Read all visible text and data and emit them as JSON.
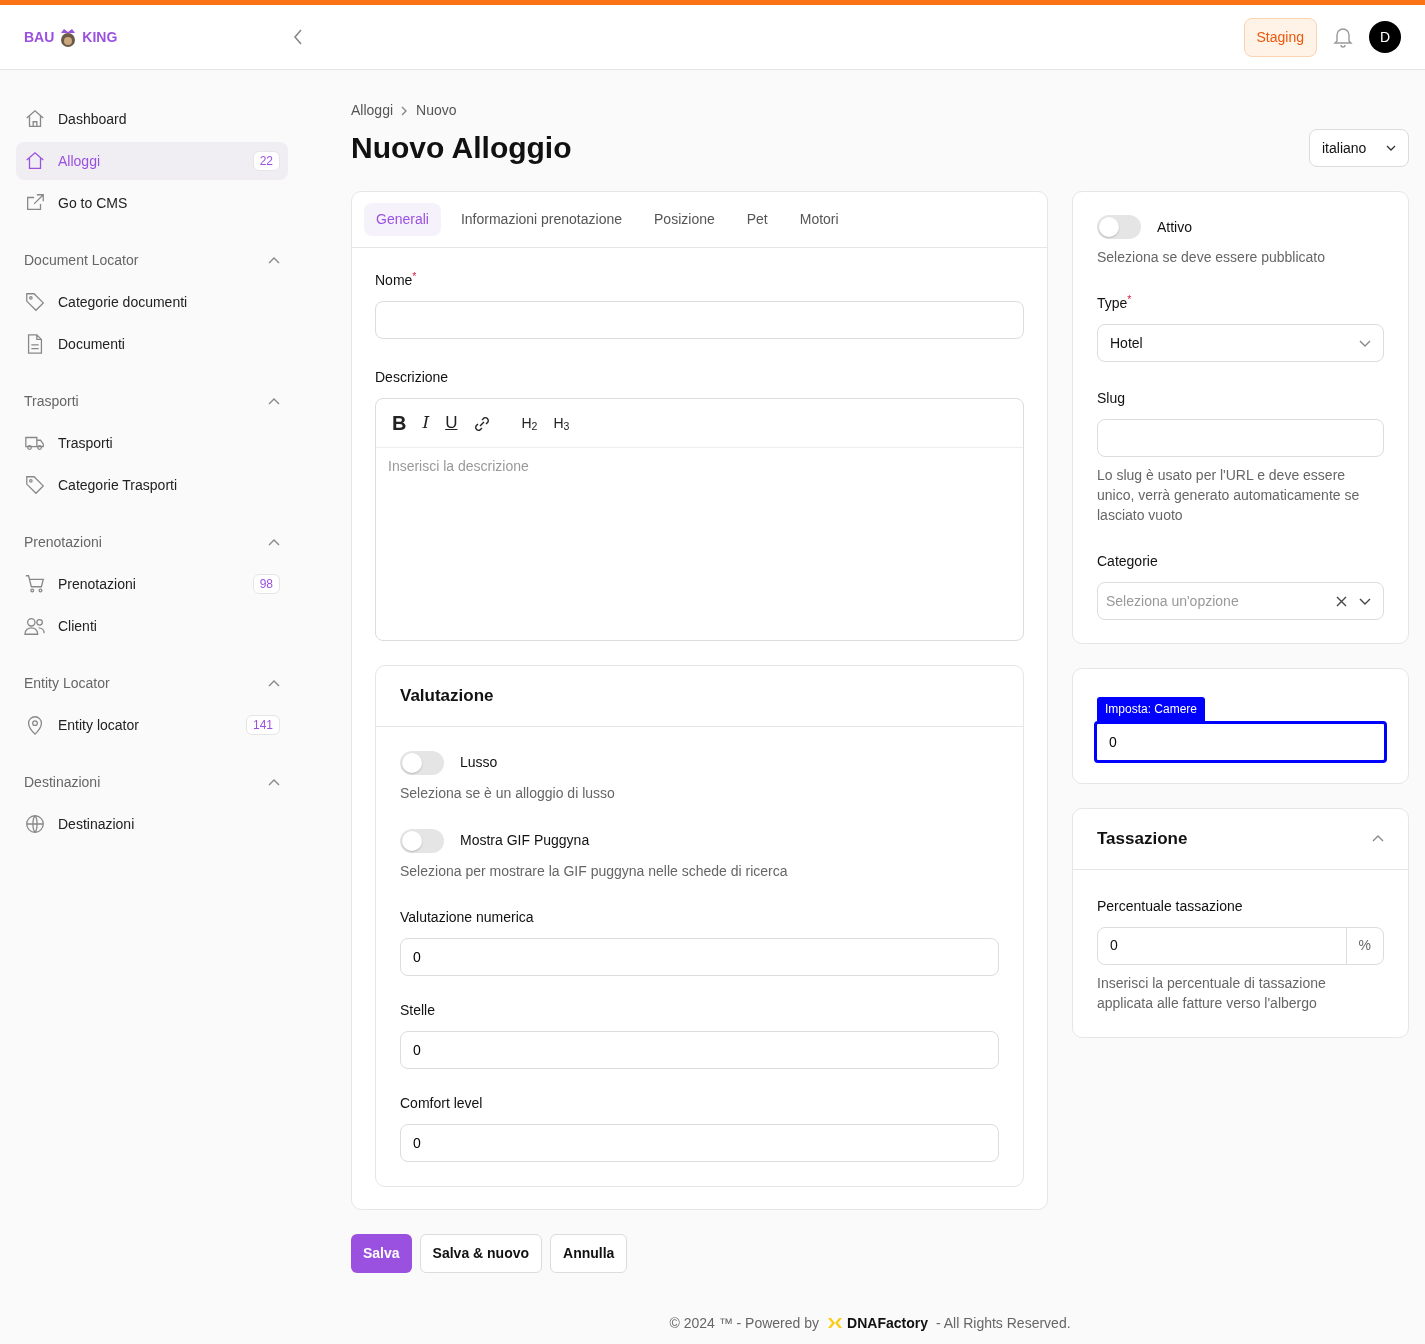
{
  "header": {
    "logo": {
      "left": "BAU",
      "right": "KING"
    },
    "environment": "Staging",
    "avatar": "D"
  },
  "sidebar": {
    "groups": [
      {
        "items": [
          {
            "label": "Dashboard",
            "selected": false
          },
          {
            "label": "Alloggi",
            "selected": true,
            "badge": "22"
          },
          {
            "label": "Go to CMS",
            "selected": false
          }
        ]
      },
      {
        "title": "Document Locator",
        "expanded": true,
        "items": [
          {
            "label": "Categorie documenti",
            "selected": false
          },
          {
            "label": "Documenti",
            "selected": false
          }
        ]
      },
      {
        "title": "Trasporti",
        "expanded": true,
        "items": [
          {
            "label": "Trasporti",
            "selected": false
          },
          {
            "label": "Categorie Trasporti",
            "selected": false
          }
        ]
      },
      {
        "title": "Prenotazioni",
        "expanded": true,
        "items": [
          {
            "label": "Prenotazioni",
            "selected": false,
            "badge": "98"
          },
          {
            "label": "Clienti",
            "selected": false
          }
        ]
      },
      {
        "title": "Entity Locator",
        "expanded": true,
        "items": [
          {
            "label": "Entity locator",
            "selected": false,
            "badge": "141"
          }
        ]
      },
      {
        "title": "Destinazioni",
        "expanded": true,
        "items": [
          {
            "label": "Destinazioni",
            "selected": false
          }
        ]
      }
    ]
  },
  "breadcrumb": [
    "Alloggi",
    "Nuovo"
  ],
  "title": "Nuovo Alloggio",
  "language": "italiano",
  "tabs": [
    {
      "label": "Generali",
      "selected": true
    },
    {
      "label": "Informazioni prenotazione",
      "selected": false
    },
    {
      "label": "Posizione",
      "selected": false
    },
    {
      "label": "Pet",
      "selected": false
    },
    {
      "label": "Motori",
      "selected": false
    }
  ],
  "nome": {
    "label": "Nome$^{*}$"
  },
  "descrizione": {
    "label": "Descrizione",
    "toolbar": [
      {
        "kind": "bold",
        "text": "B"
      },
      {
        "kind": "italic",
        "text": "I"
      },
      {
        "kind": "underline",
        "text": "U"
      },
      {
        "kind": "link"
      },
      {
        "kind": "heading",
        "text": "H$_{2}$"
      },
      {
        "kind": "heading",
        "text": "H$_{3}$"
      }
    ],
    "placeholder": "Inserisci la descrizione"
  },
  "valutazione": {
    "title": "Valutazione",
    "toggles": [
      {
        "label": "Lusso",
        "on": false,
        "help": "Seleziona se è un alloggio di lusso"
      },
      {
        "label": "Mostra GIF Puggyna",
        "on": false,
        "help": "Seleziona per mostrare la GIF puggyna nelle schede di ricerca"
      }
    ],
    "fields": [
      {
        "label": "Valutazione numerica",
        "value": "0"
      },
      {
        "label": "Stelle",
        "value": "0"
      },
      {
        "label": "Comfort level",
        "value": "0"
      }
    ]
  },
  "side": {
    "attivo": {
      "label": "Attivo",
      "on": false,
      "help": "Seleziona se deve essere pubblicato"
    },
    "type": {
      "label": "Type$^{*}$",
      "value": "Hotel"
    },
    "slug": {
      "label": "Slug",
      "help": "Lo slug è usato per l'URL e deve essere unico, verrà generato automaticamente se lasciato vuoto"
    },
    "categorie": {
      "label": "Categorie",
      "placeholder": "Seleziona un'opzione"
    }
  },
  "camere": {
    "tooltip": "Imposta: Camere",
    "value": "0"
  },
  "tassazione": {
    "title": "Tassazione",
    "expanded": true,
    "label": "Percentuale tassazione",
    "value": "0",
    "addon": "%",
    "help": "Inserisci la percentuale di tassazione applicata alle fatture verso l'albergo"
  },
  "buttons": [
    {
      "label": "Salva",
      "kind": "primary"
    },
    {
      "label": "Salva & nuovo",
      "kind": "secondary"
    },
    {
      "label": "Annulla",
      "kind": "secondary"
    }
  ],
  "footer": {
    "before": "© 2024 ™ - Powered by",
    "brand": "DNAFactory",
    "after": "- All Rights Reserved."
  }
}
